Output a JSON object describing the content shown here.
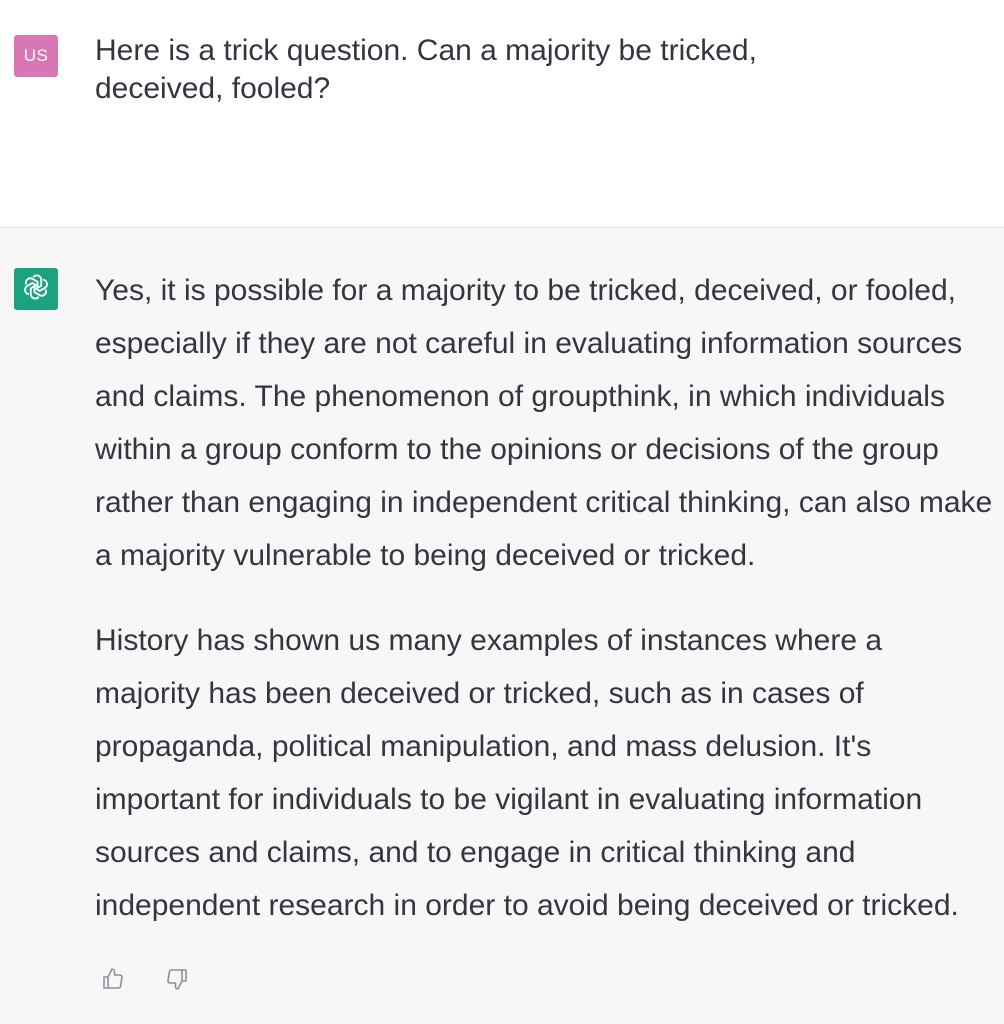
{
  "user_message": {
    "avatar_label": "US",
    "avatar_color": "#d877b5",
    "text": "Here is a trick question. Can a majority be tricked, deceived, fooled?"
  },
  "assistant_message": {
    "avatar_icon": "openai-logo-icon",
    "avatar_color": "#19a37f",
    "paragraphs": [
      "Yes, it is possible for a majority to be tricked, deceived, or fooled, especially if they are not careful in evaluating information sources and claims. The phenomenon of groupthink, in which individuals within a group conform to the opinions or decisions of the group rather than engaging in independent critical thinking, can also make a majority vulnerable to being deceived or tricked.",
      "History has shown us many examples of instances where a majority has been deceived or tricked, such as in cases of propaganda, political manipulation, and mass delusion. It's important for individuals to be vigilant in evaluating information sources and claims, and to engage in critical thinking and independent research in order to avoid being deceived or tricked."
    ],
    "feedback": {
      "thumbs_up_icon": "thumbs-up-icon",
      "thumbs_down_icon": "thumbs-down-icon"
    }
  }
}
